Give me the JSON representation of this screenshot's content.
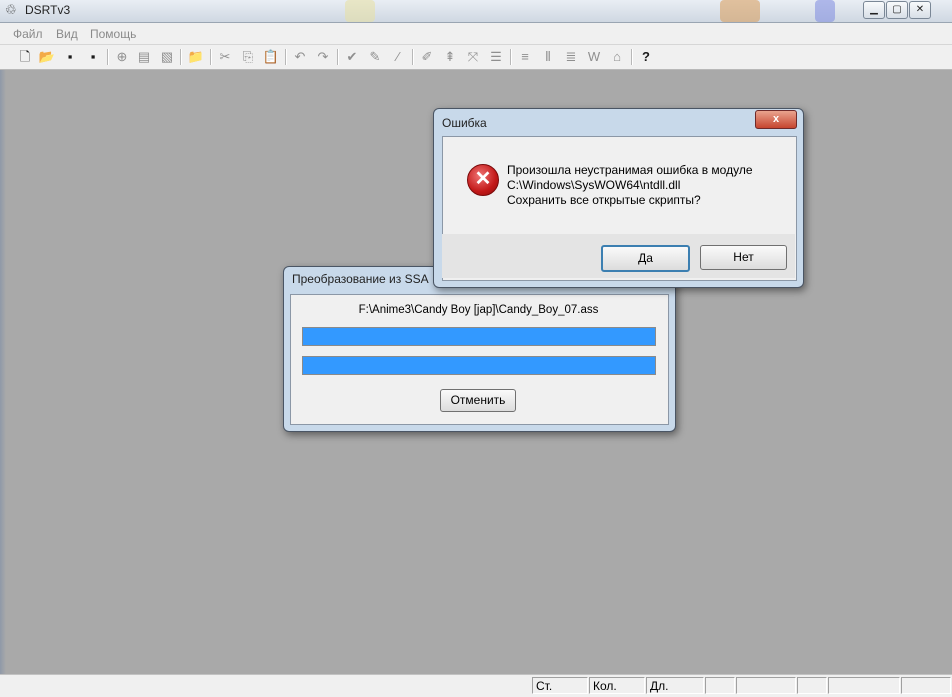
{
  "window": {
    "title": "DSRTv3"
  },
  "menu": {
    "items": [
      "Файл",
      "Вид",
      "Помощь"
    ]
  },
  "toolbar": {
    "icons": [
      "new-file-icon",
      "open-icon",
      "save-icon",
      "save-all-icon",
      "add-icon",
      "insert-icon",
      "delete-icon",
      "open-folder-icon",
      "cut-icon",
      "copy-icon",
      "paste-icon",
      "undo-icon",
      "redo-icon",
      "check-icon",
      "edit-icon",
      "wand-icon",
      "brush-icon",
      "align-icon",
      "split-icon",
      "list-icon",
      "numbered-list-icon",
      "columns-icon",
      "lines-icon",
      "word-icon",
      "home-icon",
      "help-icon"
    ]
  },
  "error_dialog": {
    "title": "Ошибка",
    "close_label": "x",
    "message_line1": "Произошла неустранимая ошибка в модуле",
    "message_line2": "C:\\Windows\\SysWOW64\\ntdll.dll",
    "message_line3": "Сохранить все открытые скрипты?",
    "yes_label": "Да",
    "no_label": "Нет"
  },
  "convert_dialog": {
    "title": "Преобразование из SSA",
    "file_path": "F:\\Anime3\\Candy Boy [jap]\\Candy_Boy_07.ass",
    "progress1": 1.0,
    "progress2": 1.0,
    "cancel_label": "Отменить"
  },
  "statusbar": {
    "st_label": "Ст.",
    "kol_label": "Кол.",
    "dl_label": "Дл."
  },
  "colors": {
    "progress": "#3399ff",
    "workspace": "#a9a9a9"
  }
}
